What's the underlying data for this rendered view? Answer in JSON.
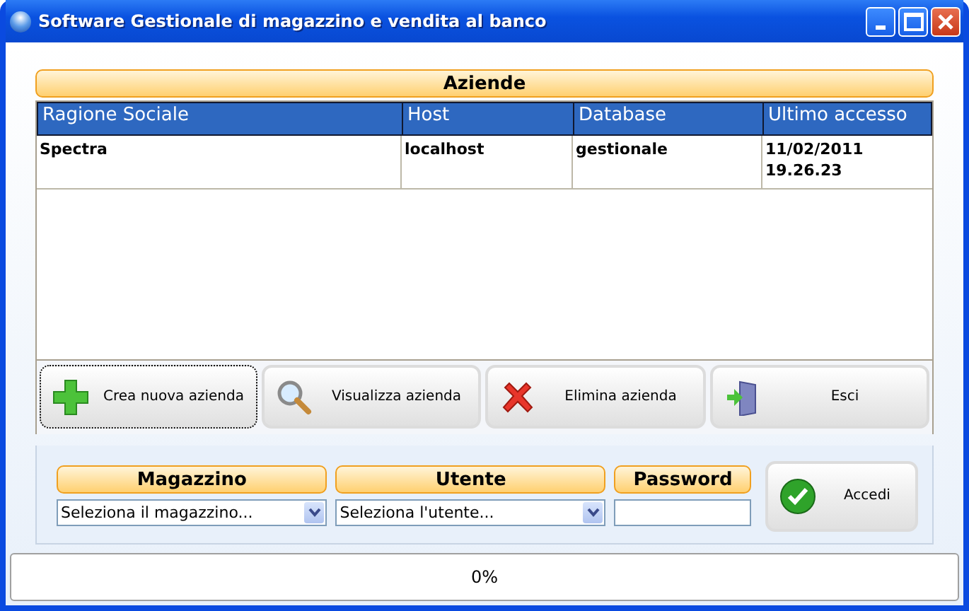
{
  "window": {
    "title": "Software Gestionale di magazzino e vendita al banco"
  },
  "companies": {
    "title": "Aziende",
    "columns": [
      "Ragione Sociale",
      "Host",
      "Database",
      "Ultimo accesso"
    ],
    "rows": [
      {
        "cells": [
          "Spectra",
          "localhost",
          "gestionale",
          "11/02/2011\n19.26.23"
        ],
        "selected": false
      }
    ]
  },
  "actions": [
    {
      "label": "Crea nuova azienda",
      "kind": "add",
      "focused": true
    },
    {
      "label": "Visualizza azienda",
      "kind": "view",
      "focused": false
    },
    {
      "label": "Elimina azienda",
      "kind": "delete",
      "focused": false
    },
    {
      "label": "Esci",
      "kind": "exit",
      "focused": false
    }
  ],
  "login": {
    "fields": [
      {
        "label": "Magazzino",
        "kind": "select",
        "value": "Seleziona il magazzino..."
      },
      {
        "label": "Utente",
        "kind": "select",
        "value": "Seleziona l'utente..."
      },
      {
        "label": "Password",
        "kind": "password"
      }
    ],
    "button": {
      "label": "Accedi",
      "kind": "ok"
    }
  },
  "status_bar": {
    "text": "0%",
    "level": 0
  }
}
